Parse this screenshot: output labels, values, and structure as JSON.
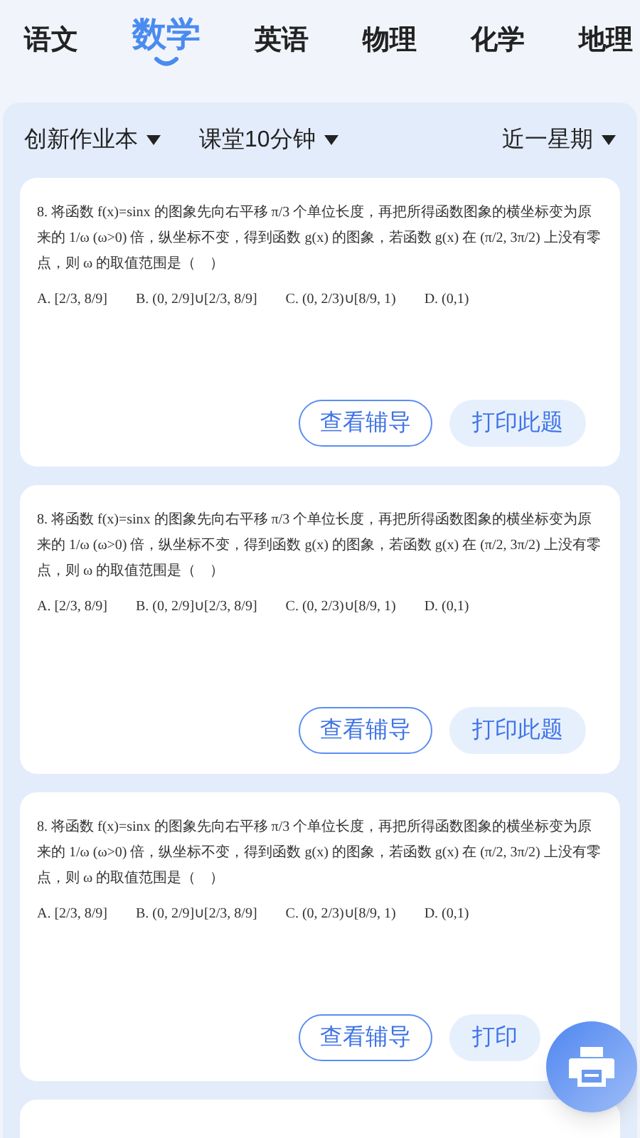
{
  "tabs": [
    {
      "label": "语文",
      "selected": false
    },
    {
      "label": "数学",
      "selected": true
    },
    {
      "label": "英语",
      "selected": false
    },
    {
      "label": "物理",
      "selected": false
    },
    {
      "label": "化学",
      "selected": false
    },
    {
      "label": "地理",
      "selected": false
    }
  ],
  "filters": {
    "left": [
      {
        "label": "创新作业本"
      },
      {
        "label": "课堂10分钟"
      }
    ],
    "right": {
      "label": "近一星期"
    }
  },
  "questions": [
    {
      "stem": "8. 将函数 f(x)=sinx 的图象先向右平移 π/3 个单位长度，再把所得函数图象的横坐标变为原来的 1/ω (ω>0) 倍，纵坐标不变，得到函数 g(x) 的图象，若函数 g(x) 在 (π/2, 3π/2) 上没有零点，则 ω 的取值范围是（　）",
      "options": [
        "A. [2/3, 8/9]",
        "B. (0, 2/9]∪[2/3, 8/9]",
        "C. (0, 2/3)∪[8/9, 1)",
        "D. (0,1)"
      ],
      "guide_button": "查看辅导",
      "print_button": "打印此题"
    },
    {
      "stem": "8. 将函数 f(x)=sinx 的图象先向右平移 π/3 个单位长度，再把所得函数图象的横坐标变为原来的 1/ω (ω>0) 倍，纵坐标不变，得到函数 g(x) 的图象，若函数 g(x) 在 (π/2, 3π/2) 上没有零点，则 ω 的取值范围是（　）",
      "options": [
        "A. [2/3, 8/9]",
        "B. (0, 2/9]∪[2/3, 8/9]",
        "C. (0, 2/3)∪[8/9, 1)",
        "D. (0,1)"
      ],
      "guide_button": "查看辅导",
      "print_button": "打印此题"
    },
    {
      "stem": "8. 将函数 f(x)=sinx 的图象先向右平移 π/3 个单位长度，再把所得函数图象的横坐标变为原来的 1/ω (ω>0) 倍，纵坐标不变，得到函数 g(x) 的图象，若函数 g(x) 在 (π/2, 3π/2) 上没有零点，则 ω 的取值范围是（　）",
      "options": [
        "A. [2/3, 8/9]",
        "B. (0, 2/9]∪[2/3, 8/9]",
        "C. (0, 2/3)∪[8/9, 1)",
        "D. (0,1)"
      ],
      "guide_button": "查看辅导",
      "print_button": "打印"
    }
  ]
}
